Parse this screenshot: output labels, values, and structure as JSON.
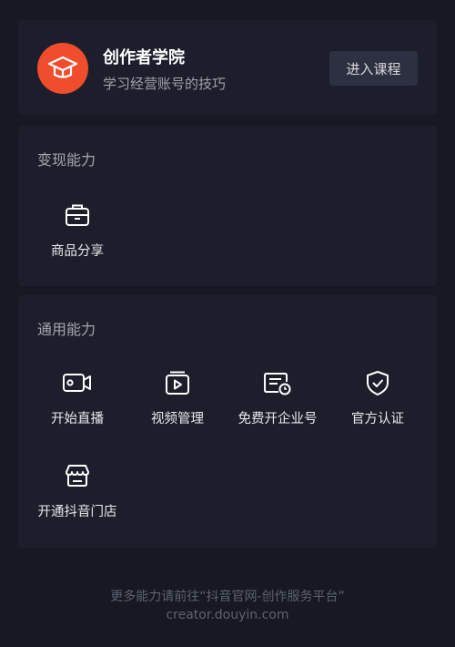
{
  "academy": {
    "title": "创作者学院",
    "subtitle": "学习经营账号的技巧",
    "button_label": "进入课程",
    "logo_icon": "graduation-cap-icon",
    "logo_color": "#f04d2d"
  },
  "monetize": {
    "title": "变现能力",
    "items": [
      {
        "label": "商品分享",
        "icon": "briefcase-icon"
      }
    ]
  },
  "general": {
    "title": "通用能力",
    "items": [
      {
        "label": "开始直播",
        "icon": "video-camera-icon"
      },
      {
        "label": "视频管理",
        "icon": "video-folder-icon"
      },
      {
        "label": "免费开企业号",
        "icon": "enterprise-card-icon"
      },
      {
        "label": "官方认证",
        "icon": "shield-check-icon"
      },
      {
        "label": "开通抖音门店",
        "icon": "storefront-icon"
      }
    ]
  },
  "footer": {
    "line1": "更多能力请前往“抖音官网-创作服务平台”",
    "line2": "creator.douyin.com"
  }
}
